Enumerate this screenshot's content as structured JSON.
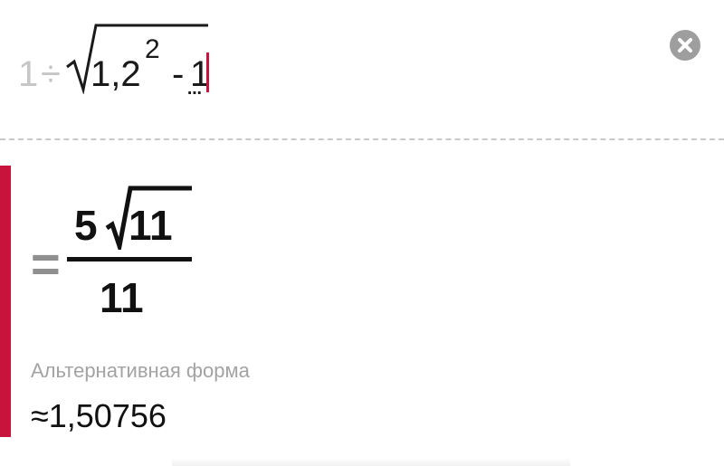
{
  "input": {
    "expression": {
      "numerator": "1",
      "operator": "÷",
      "base": "1,2",
      "exponent": "2",
      "minus": "-",
      "subtrahend": "1"
    },
    "placeholder_marker": "⋯",
    "clear_icon": "close-circle-icon"
  },
  "result": {
    "equals": "=",
    "numerator_coefficient": "5",
    "numerator_radicand": "11",
    "denominator": "11",
    "alternative_form_label": "Альтернативная форма",
    "approx_value": "≈1,50756"
  },
  "colors": {
    "accent": "#c8143c",
    "faded_text": "#c6c6c6",
    "equals_gray": "#8f8f8f",
    "label_gray": "#a3a3a3",
    "clear_button": "#9e9e9e"
  }
}
